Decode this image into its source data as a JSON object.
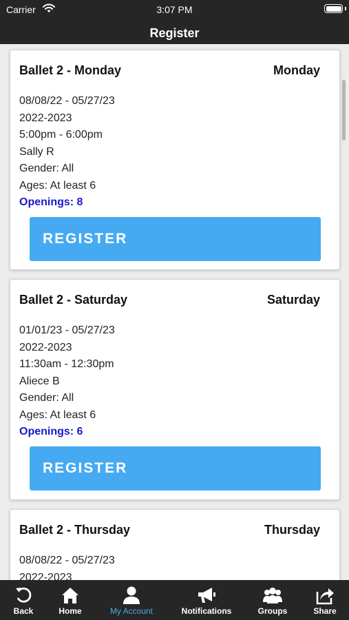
{
  "status": {
    "carrier": "Carrier",
    "time": "3:07 PM"
  },
  "header": {
    "title": "Register"
  },
  "classes": [
    {
      "name": "Ballet 2 - Monday",
      "day": "Monday",
      "dates": "08/08/22 - 05/27/23",
      "season": "2022-2023",
      "time": "5:00pm - 6:00pm",
      "instructor": "Sally R",
      "gender": "Gender: All",
      "ages": "Ages: At least 6",
      "openings": "Openings: 8",
      "button": "REGISTER"
    },
    {
      "name": "Ballet 2 - Saturday",
      "day": "Saturday",
      "dates": "01/01/23 - 05/27/23",
      "season": "2022-2023",
      "time": "11:30am - 12:30pm",
      "instructor": "Aliece B",
      "gender": "Gender: All",
      "ages": "Ages: At least 6",
      "openings": "Openings: 6",
      "button": "REGISTER"
    },
    {
      "name": "Ballet 2 - Thursday",
      "day": "Thursday",
      "dates": "08/08/22 - 05/27/23",
      "season": "2022-2023"
    }
  ],
  "tabs": [
    {
      "label": "Back",
      "icon": "back-arrow-icon"
    },
    {
      "label": "Home",
      "icon": "home-icon"
    },
    {
      "label": "My Account",
      "icon": "user-icon",
      "active": true
    },
    {
      "label": "Notifications",
      "icon": "megaphone-icon"
    },
    {
      "label": "Groups",
      "icon": "group-icon"
    },
    {
      "label": "Share",
      "icon": "share-icon"
    }
  ],
  "colors": {
    "bar": "#262626",
    "button": "#45aaf2",
    "openings": "#1a19c9",
    "active_tab": "#4ea6e6"
  }
}
